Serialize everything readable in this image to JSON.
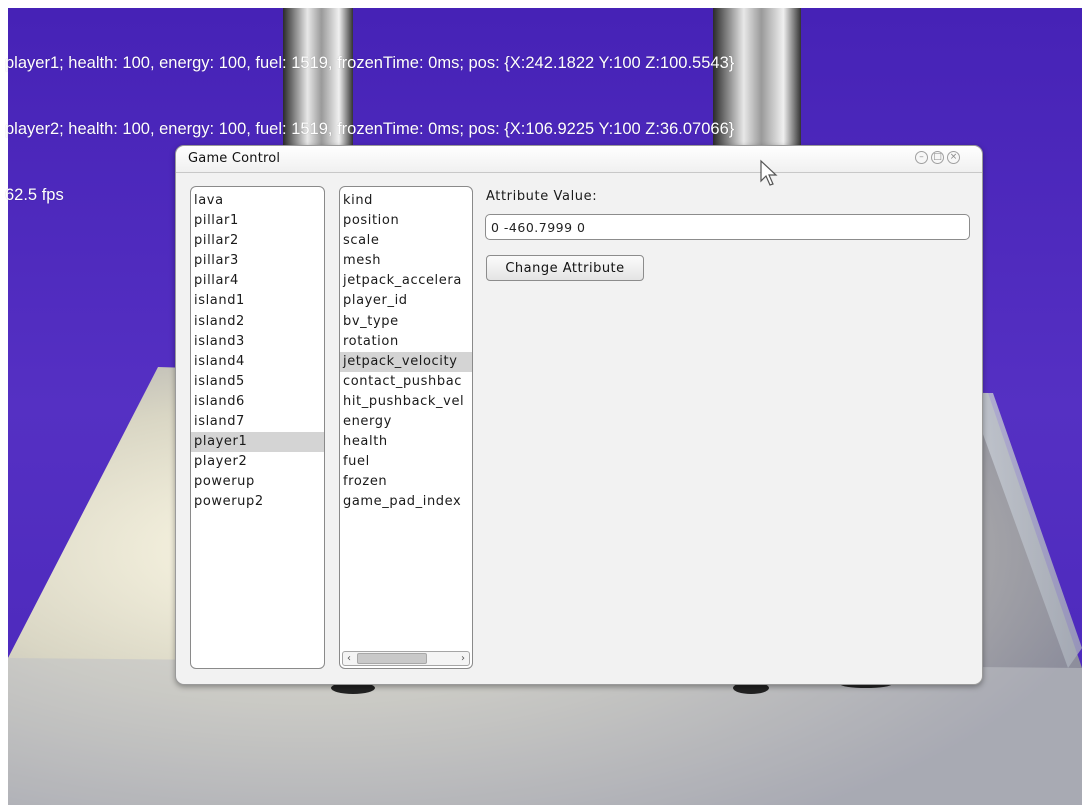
{
  "hud": {
    "lines": [
      "player1; health: 100, energy: 100, fuel: 1519, frozenTime: 0ms; pos: {X:242.1822 Y:100 Z:100.5543}",
      "player2; health: 100, energy: 100, fuel: 1519, frozenTime: 0ms; pos: {X:106.9225 Y:100 Z:36.07066}",
      "62.5 fps"
    ]
  },
  "dialog": {
    "title": "Game Control",
    "objects": {
      "items": [
        "lava",
        "pillar1",
        "pillar2",
        "pillar3",
        "pillar4",
        "island1",
        "island2",
        "island3",
        "island4",
        "island5",
        "island6",
        "island7",
        "player1",
        "player2",
        "powerup",
        "powerup2"
      ],
      "selected": "player1"
    },
    "attributes": {
      "items": [
        "kind",
        "position",
        "scale",
        "mesh",
        "jetpack_accelera",
        "player_id",
        "bv_type",
        "rotation",
        "jetpack_velocity",
        "contact_pushbac",
        "hit_pushback_vel",
        "energy",
        "health",
        "fuel",
        "frozen",
        "game_pad_index"
      ],
      "selected": "jetpack_velocity"
    },
    "value_label": "Attribute Value:",
    "value": "0 -460.7999 0",
    "change_button": "Change Attribute"
  },
  "icons": {
    "minimize": "minimize-icon",
    "maximize": "maximize-icon",
    "close": "close-icon",
    "cursor": "mouse-pointer-icon",
    "scroll_left": "chevron-left-icon",
    "scroll_right": "chevron-right-icon"
  },
  "colors": {
    "sky": "#4a27ba",
    "dialog_bg": "#f2f2f2",
    "selection": "#d4d4d4"
  }
}
